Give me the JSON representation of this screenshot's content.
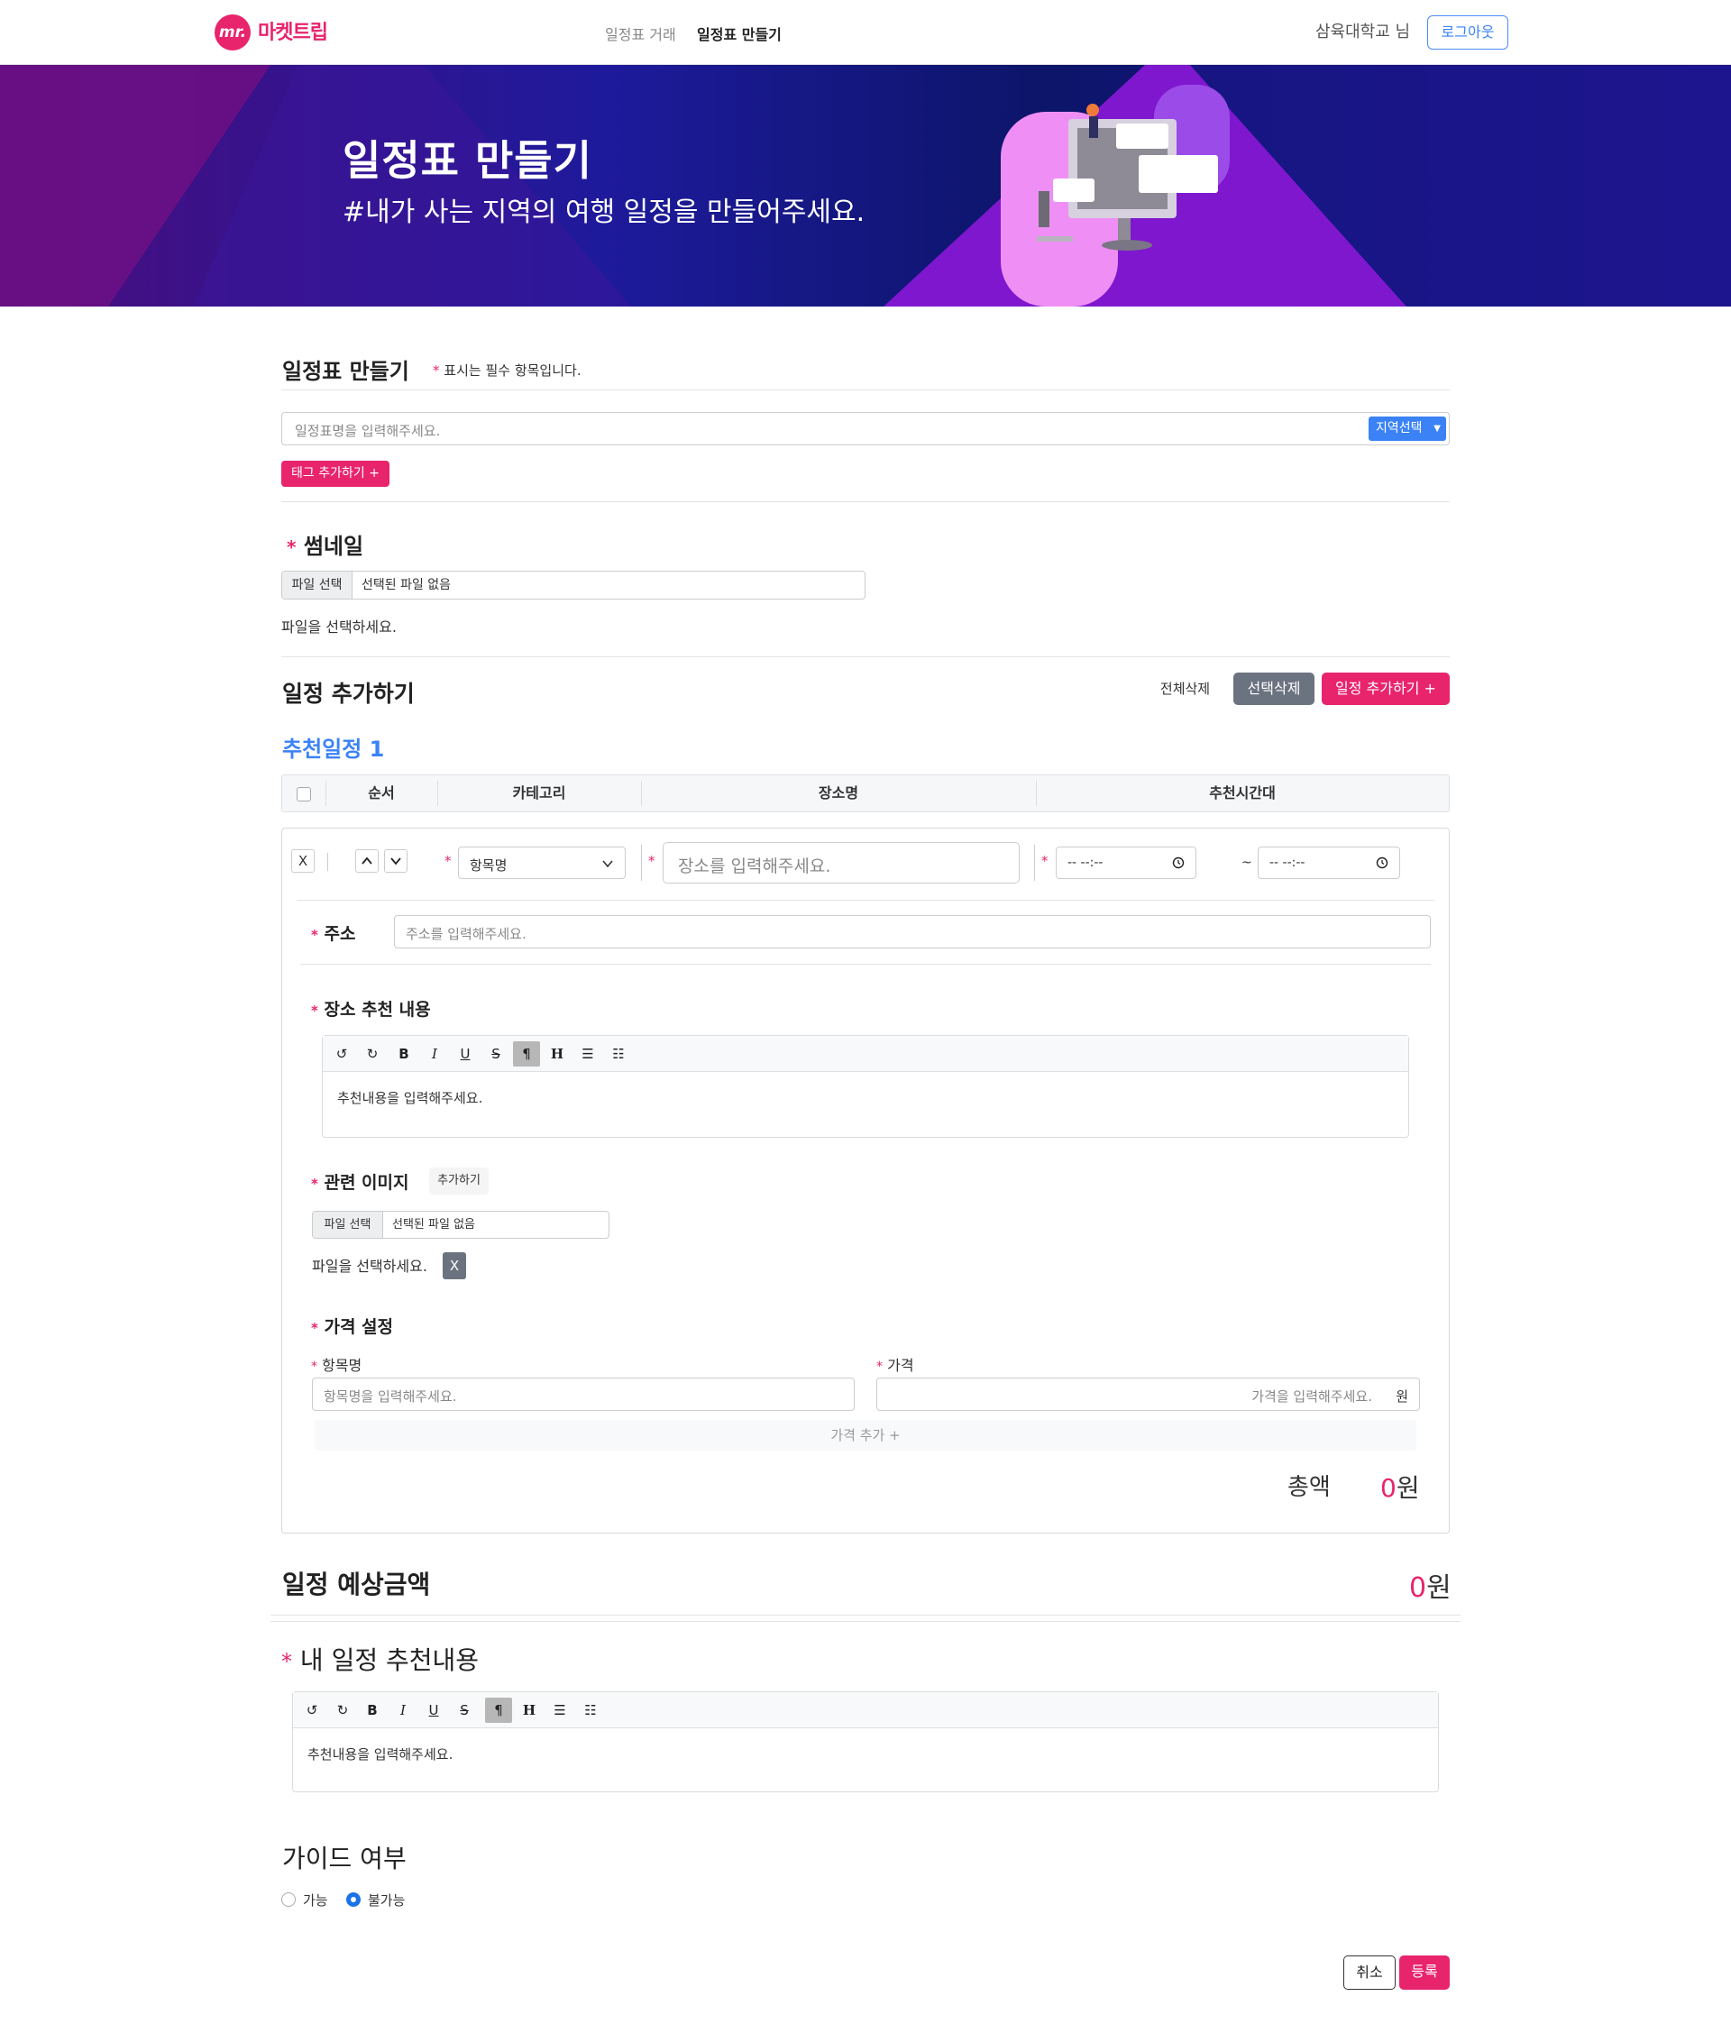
{
  "header": {
    "logo_mark": "mr.",
    "logo_text": "마켓트립",
    "nav": [
      "일정표 거래",
      "일정표 만들기"
    ],
    "user": "삼육대학교 님",
    "logout": "로그아웃"
  },
  "banner": {
    "title": "일정표 만들기",
    "subtitle": "#내가 사는 지역의 여행 일정을 만들어주세요."
  },
  "form": {
    "title": "일정표 만들기",
    "required_note": "표시는 필수 항목입니다.",
    "required_mark": "*",
    "name_placeholder": "일정표명을 입력해주세요.",
    "region_select": "지역선택",
    "add_tag": "태그 추가하기 +",
    "thumbnail_title": "썸네일",
    "file_button": "파일 선택",
    "file_none": "선택된 파일 없음",
    "file_hint": "파일을 선택하세요."
  },
  "schedule": {
    "title": "일정 추가하기",
    "delete_all": "전체삭제",
    "delete_selected": "선택삭제",
    "add_schedule": "일정 추가하기 +",
    "subtitle": "추천일정 1",
    "columns": [
      "순서",
      "카테고리",
      "장소명",
      "추천시간대"
    ],
    "row": {
      "remove": "X",
      "category": "항목명",
      "place_placeholder": "장소를 입력해주세요.",
      "time_start": "-- --:--",
      "time_end": "-- --:--",
      "tilde": "~"
    },
    "address_label": "주소",
    "address_placeholder": "주소를 입력해주세요.",
    "recommend_label": "장소 추천 내용",
    "editor_placeholder": "추천내용을 입력해주세요.",
    "toolbar": [
      "↺",
      "↻",
      "B",
      "I",
      "U",
      "S",
      "¶",
      "H",
      "☰",
      "☷"
    ],
    "images_label": "관련 이미지",
    "images_add": "추가하기",
    "file_button": "파일 선택",
    "file_none": "선택된 파일 없음",
    "file_hint": "파일을 선택하세요.",
    "file_remove": "X",
    "price_label": "가격 설정",
    "item_label": "항목명",
    "item_placeholder": "항목명을 입력해주세요.",
    "price_field_label": "가격",
    "price_placeholder": "가격을 입력해주세요.",
    "price_unit": "원",
    "add_price": "가격 추가 +",
    "total_label": "총액",
    "total_value": "0",
    "total_unit": "원"
  },
  "estimate": {
    "title": "일정 예상금액",
    "value": "0",
    "unit": "원"
  },
  "my_recommend": {
    "title": "내 일정 추천내용",
    "editor_placeholder": "추천내용을 입력해주세요."
  },
  "guide": {
    "title": "가이드 여부",
    "options": [
      "가능",
      "불가능"
    ],
    "selected": "불가능"
  },
  "footer": {
    "cancel": "취소",
    "submit": "등록"
  },
  "colors": {
    "brand": "#e8246d",
    "accent": "#3b82f6",
    "banner_dark": "#0c1569"
  }
}
